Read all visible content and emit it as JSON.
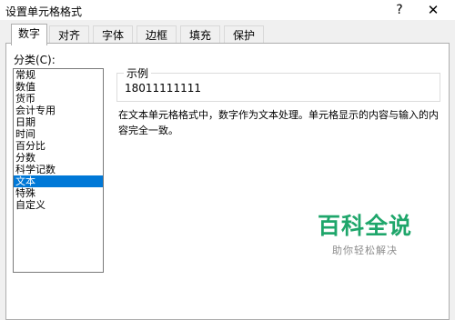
{
  "window": {
    "title": "设置单元格格式",
    "help_label": "?",
    "close_label": "✕"
  },
  "tabs": [
    {
      "label": "数字",
      "active": true
    },
    {
      "label": "对齐",
      "active": false
    },
    {
      "label": "字体",
      "active": false
    },
    {
      "label": "边框",
      "active": false
    },
    {
      "label": "填充",
      "active": false
    },
    {
      "label": "保护",
      "active": false
    }
  ],
  "category": {
    "label": "分类(C):",
    "items": [
      "常规",
      "数值",
      "货币",
      "会计专用",
      "日期",
      "时间",
      "百分比",
      "分数",
      "科学记数",
      "文本",
      "特殊",
      "自定义"
    ],
    "selected": "文本"
  },
  "sample": {
    "label": "示例",
    "value": "18011111111"
  },
  "description": "在文本单元格格式中，数字作为文本处理。单元格显示的内容与输入的内容完全一致。",
  "watermark": {
    "title": "百科全说",
    "subtitle": "助你轻松解决"
  },
  "colors": {
    "selection": "#0078d7",
    "watermark_green": "#1fa66b"
  }
}
